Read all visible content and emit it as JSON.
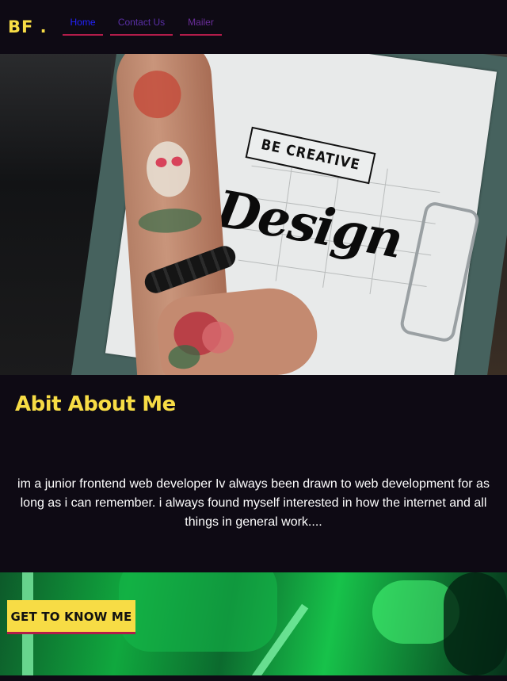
{
  "brand": {
    "logo": "BF ."
  },
  "nav": {
    "links": [
      {
        "label": "Home"
      },
      {
        "label": "Contact Us"
      },
      {
        "label": "Mailer"
      }
    ]
  },
  "hero": {
    "banner_text": "BE CREATIVE",
    "design_text": "Design"
  },
  "about": {
    "title": "Abit About Me",
    "text": "im a junior frontend web developer Iv always been drawn to web development for as long as i can remember. i always found myself interested in how the internet and all things in general work...."
  },
  "cta": {
    "label": "GET TO KNOW ME"
  },
  "colors": {
    "background": "#0e0a14",
    "accent_yellow": "#f7dc45",
    "accent_red": "#b21c4a"
  }
}
